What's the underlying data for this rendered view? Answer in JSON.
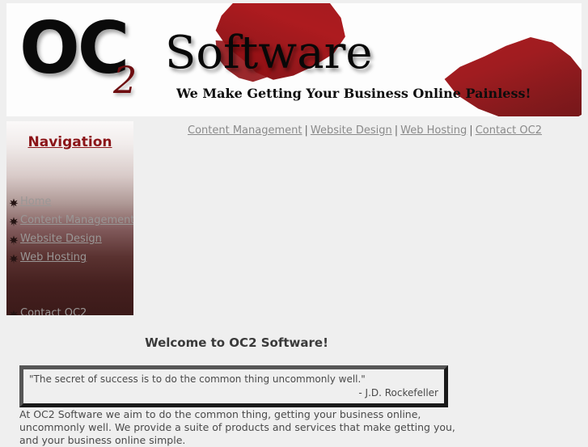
{
  "header": {
    "logo_main": "OC",
    "logo_sub": "2",
    "logo_word": "Software",
    "tagline": "We Make Getting Your Business Online Painless!",
    "accent_red": "#a31317",
    "logo_black": "#0a0a0a",
    "sub_red": "#6e0d10"
  },
  "topnav": {
    "separator": "|",
    "items": [
      {
        "label": "Content Management"
      },
      {
        "label": "Website Design"
      },
      {
        "label": "Web Hosting"
      },
      {
        "label": "Contact OC2"
      }
    ]
  },
  "sidebar": {
    "title": "Navigation",
    "title_color": "#8b1418",
    "link_color": "#9a9796",
    "items": [
      {
        "label": "Home",
        "icon": "fleur-bullet-icon"
      },
      {
        "label": "Content Management",
        "icon": "fleur-bullet-icon"
      },
      {
        "label": "Website Design",
        "icon": "fleur-bullet-icon"
      },
      {
        "label": "Web Hosting",
        "icon": "fleur-bullet-icon"
      },
      {
        "label": "Contact OC2",
        "icon": "fleur-bullet-icon"
      }
    ]
  },
  "main": {
    "welcome_heading": "Welcome to OC2 Software!",
    "quote": "\"The secret of success is to do the common thing uncommonly well.\"",
    "quote_attribution": "- J.D. Rockefeller",
    "body_paragraph": "At OC2 Software we aim to do the common thing, getting your business online, uncommonly well. We provide a suite of products and services that make getting you, and your business online simple."
  }
}
